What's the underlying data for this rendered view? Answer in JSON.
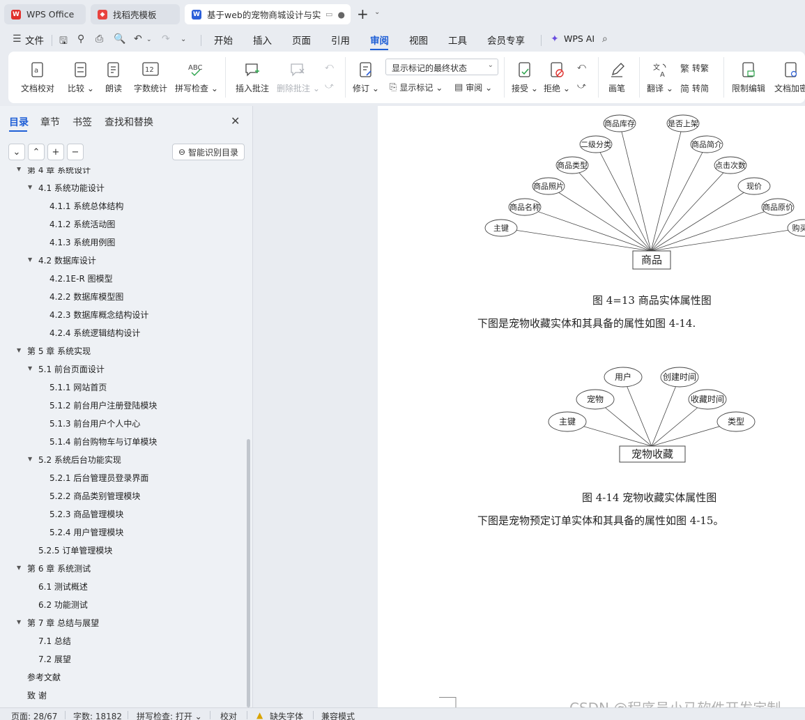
{
  "tabs": [
    {
      "label": "WPS Office",
      "icon": "wps-logo-icon"
    },
    {
      "label": "找稻壳模板",
      "icon": "docer-icon"
    },
    {
      "label": "基于web的宠物商城设计与实现",
      "icon": "word-doc-icon"
    }
  ],
  "menu": {
    "file_label": "文件",
    "items": [
      "开始",
      "插入",
      "页面",
      "引用",
      "审阅",
      "视图",
      "工具",
      "会员专享"
    ],
    "active": "审阅",
    "ai_label": "WPS AI"
  },
  "ribbon": {
    "proofread": "文档校对",
    "compare": "比较",
    "read_aloud": "朗读",
    "word_count": "字数统计",
    "spell_check": "拼写检查",
    "insert_comment": "插入批注",
    "delete_comment": "删除批注",
    "revise": "修订",
    "markup_select": "显示标记的最终状态",
    "show_markup": "显示标记",
    "review_pane": "审阅",
    "accept": "接受",
    "reject": "拒绝",
    "ink": "画笔",
    "translate": "翻译",
    "to_traditional": "转繁",
    "to_simplified": "转简",
    "restrict_edit": "限制编辑",
    "doc_encrypt": "文档加密"
  },
  "nav": {
    "tabs": [
      "目录",
      "章节",
      "书签",
      "查找和替换"
    ],
    "active_tab": "目录",
    "smart_toc": "智能识别目录",
    "toc": [
      {
        "text": "第 4 章  系统设计",
        "level": 1,
        "expanded": true
      },
      {
        "text": "4.1  系统功能设计",
        "level": 2,
        "expanded": true
      },
      {
        "text": "4.1.1 系统总体结构",
        "level": 3
      },
      {
        "text": "4.1.2 系统活动图",
        "level": 3
      },
      {
        "text": "4.1.3 系统用例图",
        "level": 3
      },
      {
        "text": "4.2 数据库设计",
        "level": 2,
        "expanded": true
      },
      {
        "text": "4.2.1E-R 图模型",
        "level": 3
      },
      {
        "text": "4.2.2 数据库模型图",
        "level": 3
      },
      {
        "text": "4.2.3 数据库概念结构设计",
        "level": 3
      },
      {
        "text": "4.2.4 系统逻辑结构设计",
        "level": 3
      },
      {
        "text": "第 5 章  系统实现",
        "level": 1,
        "expanded": true
      },
      {
        "text": "5.1 前台页面设计",
        "level": 2,
        "expanded": true
      },
      {
        "text": "5.1.1 网站首页",
        "level": 3
      },
      {
        "text": "5.1.2 前台用户注册登陆模块",
        "level": 3
      },
      {
        "text": "5.1.3 前台用户个人中心",
        "level": 3
      },
      {
        "text": "5.1.4 前台购物车与订单模块",
        "level": 3
      },
      {
        "text": "5.2 系统后台功能实现",
        "level": 2,
        "expanded": true
      },
      {
        "text": "5.2.1 后台管理员登录界面",
        "level": 3
      },
      {
        "text": "5.2.2 商品类别管理模块",
        "level": 3
      },
      {
        "text": "5.2.3 商品管理模块",
        "level": 3
      },
      {
        "text": "5.2.4 用户管理模块",
        "level": 3
      },
      {
        "text": "5.2.5 订单管理模块",
        "level": 2
      },
      {
        "text": "第 6 章  系统测试",
        "level": 1,
        "expanded": true
      },
      {
        "text": "6.1 测试概述",
        "level": 2
      },
      {
        "text": "6.2 功能测试",
        "level": 2
      },
      {
        "text": "第 7 章  总结与展望",
        "level": 1,
        "expanded": true
      },
      {
        "text": "7.1 总结",
        "level": 2
      },
      {
        "text": "7.2 展望",
        "level": 2
      },
      {
        "text": "参考文献",
        "level": 1
      },
      {
        "text": "致  谢",
        "level": 1
      }
    ]
  },
  "document": {
    "diagram1": {
      "entity": "商品",
      "attributes": [
        "主键",
        "商品名称",
        "商品照片",
        "商品类型",
        "二级分类",
        "商品库存",
        "是否上架",
        "商品简介",
        "点击次数",
        "现价",
        "商品原价",
        "购买数"
      ]
    },
    "caption1": "图 4=13 商品实体属性图",
    "para1": "下图是宠物收藏实体和其具备的属性如图 4-14.",
    "diagram2": {
      "entity": "宠物收藏",
      "attributes": [
        "主键",
        "宠物",
        "用户",
        "创建时间",
        "收藏时间",
        "类型"
      ]
    },
    "caption2": "图 4-14  宠物收藏实体属性图",
    "para2": "下图是宠物预定订单实体和其具备的属性如图 4-15。"
  },
  "watermark": "CSDN @程序员小马软件开发定制",
  "status": {
    "page": "页面: 28/67",
    "words": "字数: 18182",
    "spell": "拼写检查: 打开",
    "proof": "校对",
    "missing_font": "缺失字体",
    "compat": "兼容模式"
  }
}
